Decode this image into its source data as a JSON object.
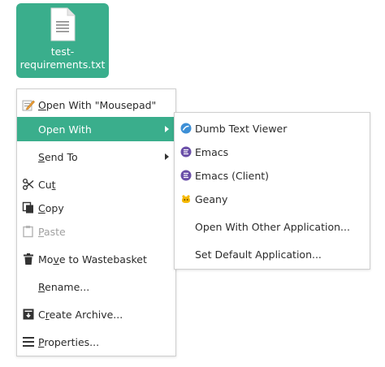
{
  "desktop": {
    "file_icon": "text-file-icon",
    "file_name_line1": "test-",
    "file_name_line2": "requirements.txt"
  },
  "context_menu": {
    "items": [
      {
        "icon": "pencil-icon",
        "pre": "",
        "ul": "O",
        "post": "pen With \"Mousepad\""
      },
      {
        "icon": "",
        "pre": "Open With",
        "ul": "",
        "post": "",
        "submenu": true,
        "active": true
      },
      {
        "icon": "",
        "pre": "",
        "ul": "S",
        "post": "end To",
        "submenu": true
      },
      {
        "icon": "scissors-icon",
        "pre": "Cu",
        "ul": "t",
        "post": ""
      },
      {
        "icon": "copy-icon",
        "pre": "",
        "ul": "C",
        "post": "opy"
      },
      {
        "icon": "paste-icon",
        "pre": "",
        "ul": "P",
        "post": "aste",
        "disabled": true
      },
      {
        "icon": "trash-icon",
        "pre": "Mo",
        "ul": "v",
        "post": "e to Wastebasket"
      },
      {
        "icon": "",
        "pre": "",
        "ul": "R",
        "post": "ename..."
      },
      {
        "icon": "archive-icon",
        "pre": "C",
        "ul": "r",
        "post": "eate Archive..."
      },
      {
        "icon": "properties-icon",
        "pre": "",
        "ul": "P",
        "post": "roperties..."
      }
    ]
  },
  "open_with_submenu": {
    "items": [
      {
        "icon": "dumb-text-viewer-icon",
        "label": "Dumb Text Viewer"
      },
      {
        "icon": "emacs-icon",
        "label": "Emacs"
      },
      {
        "icon": "emacs-icon",
        "label": "Emacs (Client)"
      },
      {
        "icon": "geany-icon",
        "label": "Geany"
      },
      {
        "icon": "",
        "label": "Open With Other Application..."
      },
      {
        "icon": "",
        "label": "Set Default Application..."
      }
    ]
  },
  "colors": {
    "accent": "#3aae8c",
    "menu_border": "#cfcfcf",
    "disabled_text": "#a0a0a0"
  }
}
